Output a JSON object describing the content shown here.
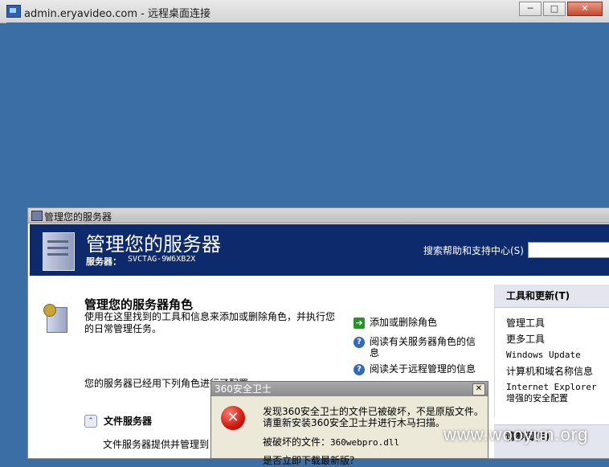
{
  "window": {
    "title": "admin.eryavideo.com - 远程桌面连接",
    "buttons": {
      "minimize": "─",
      "maximize": "□",
      "close": "✕"
    }
  },
  "manage_server": {
    "window_title": "管理您的服务器",
    "banner_title": "管理您的服务器",
    "server_label": "服务器：",
    "server_name": "SVCTAG-9W6XB2X",
    "search_label": "搜索帮助和支持中心(S)",
    "search_value": "",
    "roles_heading": "管理您的服务器角色",
    "roles_desc": "使用在这里找到的工具和信息来添加或删除角色，并执行您的日常管理任务。",
    "actions": [
      {
        "label": "添加或删除角色",
        "icon": "arrow-icon"
      },
      {
        "label": "阅读有关服务器角色的信息",
        "icon": "help-icon"
      },
      {
        "label": "阅读关于远程管理的信息",
        "icon": "help-icon"
      }
    ],
    "configured_text": "您的服务器已经用下列角色进行了配置",
    "file_server": {
      "title": "文件服务器",
      "desc": "文件服务器提供并管理到"
    },
    "side_panel": {
      "heading": "工具和更新(T)",
      "items": [
        "管理工具",
        "更多工具",
        "Windows Update",
        "计算机和域名称信息",
        "Internet Explorer 增强的安全配置"
      ],
      "second_heading": "请参阅(E)"
    }
  },
  "dialog": {
    "title": "360安全卫士",
    "close": "✕",
    "icon": "error-icon",
    "message_line1": "发现360安全卫士的文件已被破坏，不是原版文件。",
    "message_line2": "请重新安装360安全卫士并进行木马扫描。",
    "file_label": "被破坏的文件：",
    "file_name": "360webpro.dll",
    "more_text": "是否立即下载最新版？"
  },
  "watermark": "www.wooyun.org"
}
